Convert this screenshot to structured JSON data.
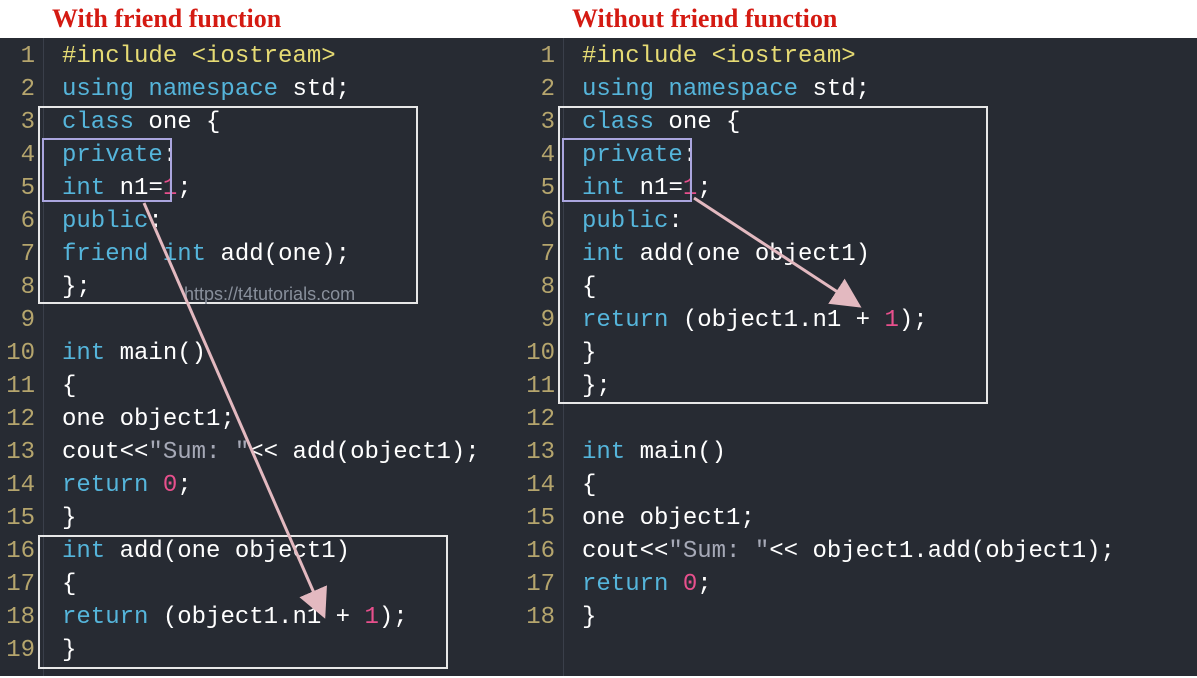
{
  "left": {
    "heading": "With friend function",
    "lines": {
      "l1": {
        "n": "1",
        "prep": "#include <iostream>"
      },
      "l2": {
        "n": "2",
        "kw": "using namespace",
        "id": " std",
        "p": ";"
      },
      "l3": {
        "n": "3",
        "kw": "class",
        "id": " one ",
        "p": "{"
      },
      "l4": {
        "n": "4",
        "kw": "private",
        "p": ":"
      },
      "l5": {
        "n": "5",
        "type": "int",
        "id": " n1",
        "op": "=",
        "num": "1",
        "p": ";"
      },
      "l6": {
        "n": "6",
        "kw": "public",
        "p": ":"
      },
      "l7": {
        "n": "7",
        "kw": "friend ",
        "type": "int",
        "id": " add",
        "p1": "(",
        "arg": "one",
        "p2": ");"
      },
      "l8": {
        "n": "8",
        "p": "};"
      },
      "l9": {
        "n": "9"
      },
      "l10": {
        "n": "10",
        "type": "int",
        "id": " main",
        "p": "()"
      },
      "l11": {
        "n": "11",
        "p": "{"
      },
      "l12": {
        "n": "12",
        "id": "one object1",
        "p": ";"
      },
      "l13": {
        "n": "13",
        "id1": "cout",
        "op1": "<<",
        "q": "\"Sum: \"",
        "op2": "<<",
        "id2": " add",
        "p1": "(",
        "arg": "object1",
        "p2": ");"
      },
      "l14": {
        "n": "14",
        "kw": "return ",
        "num": "0",
        "p": ";"
      },
      "l15": {
        "n": "15",
        "p": "}"
      },
      "l16": {
        "n": "16",
        "type": "int",
        "id": " add",
        "p1": "(",
        "arg": "one object1",
        "p2": ")"
      },
      "l17": {
        "n": "17",
        "p": "{"
      },
      "l18": {
        "n": "18",
        "kw": "return ",
        "p1": "(",
        "id": "object1.n1 ",
        "op": "+",
        "num": " 1",
        "p2": ");"
      },
      "l19": {
        "n": "19",
        "p": "}"
      }
    },
    "watermark": "https://t4tutorials.com"
  },
  "right": {
    "heading": "Without friend function",
    "lines": {
      "l1": {
        "n": "1",
        "prep": "#include <iostream>"
      },
      "l2": {
        "n": "2",
        "kw": "using namespace",
        "id": " std",
        "p": ";"
      },
      "l3": {
        "n": "3",
        "kw": "class",
        "id": " one ",
        "p": "{"
      },
      "l4": {
        "n": "4",
        "kw": "private",
        "p": ":"
      },
      "l5": {
        "n": "5",
        "type": "int",
        "id": " n1",
        "op": "=",
        "num": "1",
        "p": ";"
      },
      "l6": {
        "n": "6",
        "kw": "public",
        "p": ":"
      },
      "l7": {
        "n": "7",
        "type": "int",
        "id": " add",
        "p1": "(",
        "arg": "one object1",
        "p2": ")"
      },
      "l8": {
        "n": "8",
        "p": "{"
      },
      "l9": {
        "n": "9",
        "kw": "return ",
        "p1": "(",
        "id": "object1.n1 ",
        "op": "+",
        "num": " 1",
        "p2": ");"
      },
      "l10": {
        "n": "10",
        "p": "}"
      },
      "l11": {
        "n": "11",
        "p": "};"
      },
      "l12": {
        "n": "12"
      },
      "l13": {
        "n": "13",
        "type": "int",
        "id": " main",
        "p": "()"
      },
      "l14": {
        "n": "14",
        "p": "{"
      },
      "l15": {
        "n": "15",
        "id": "one object1",
        "p": ";"
      },
      "l16": {
        "n": "16",
        "id1": "cout",
        "op1": "<<",
        "q": "\"Sum: \"",
        "op2": "<<",
        "id2": " object1.add",
        "p1": "(",
        "arg": "object1",
        "p2": ");"
      },
      "l17": {
        "n": "17",
        "kw": "return ",
        "num": "0",
        "p": ";"
      },
      "l18": {
        "n": "18",
        "p": "}"
      }
    }
  }
}
